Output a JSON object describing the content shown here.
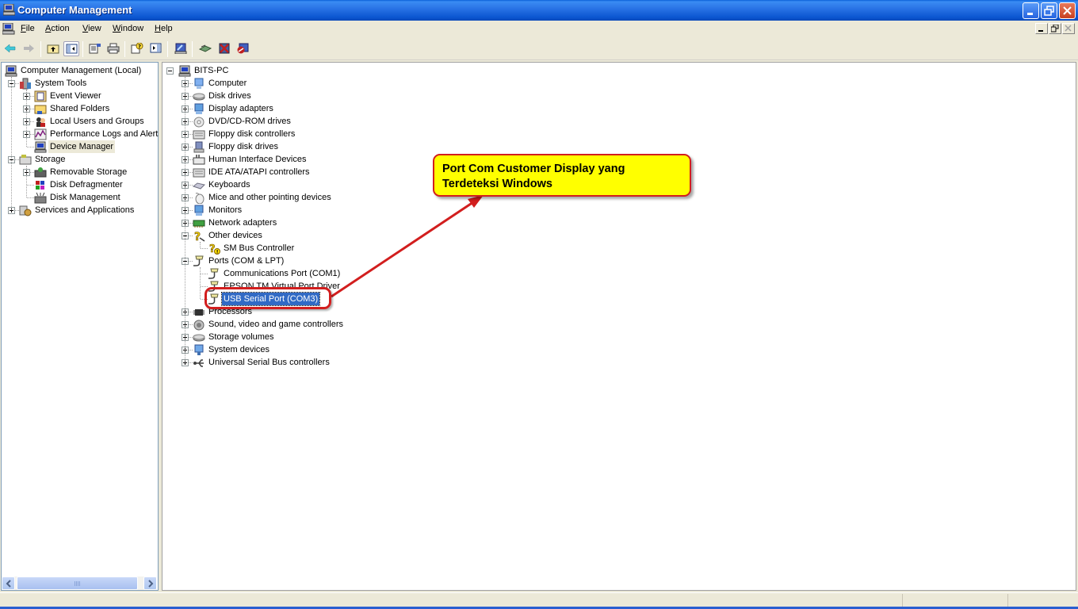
{
  "window": {
    "title": "Computer Management",
    "controls": {
      "minimize": "minimize",
      "restore": "restore",
      "close": "close"
    }
  },
  "menubar": {
    "items": [
      {
        "label": "File",
        "accel": "F"
      },
      {
        "label": "Action",
        "accel": "A"
      },
      {
        "label": "View",
        "accel": "V"
      },
      {
        "label": "Window",
        "accel": "W"
      },
      {
        "label": "Help",
        "accel": "H"
      }
    ]
  },
  "toolbar": {
    "buttons": [
      {
        "name": "back",
        "icon": "back-arrow-icon"
      },
      {
        "name": "forward",
        "icon": "forward-arrow-icon",
        "disabled": true
      },
      {
        "name": "up-one-level",
        "icon": "folder-up-icon"
      },
      {
        "name": "show-hide-console-tree",
        "icon": "console-tree-icon",
        "pressed": true
      },
      {
        "name": "properties",
        "icon": "properties-icon"
      },
      {
        "name": "print",
        "icon": "printer-icon"
      },
      {
        "name": "help",
        "icon": "help-icon"
      },
      {
        "name": "show-hide-action-pane",
        "icon": "action-pane-icon"
      },
      {
        "name": "scan-hardware-changes",
        "icon": "scan-hardware-icon"
      },
      {
        "name": "update-driver",
        "icon": "update-driver-icon"
      },
      {
        "name": "uninstall",
        "icon": "uninstall-icon"
      },
      {
        "name": "disable",
        "icon": "disable-icon"
      }
    ]
  },
  "console_tree": {
    "root": "Computer Management (Local)",
    "items": [
      {
        "label": "System Tools",
        "level": 1,
        "expander": "minus",
        "icon": "system-tools-icon"
      },
      {
        "label": "Event Viewer",
        "level": 2,
        "expander": "plus",
        "icon": "event-viewer-icon"
      },
      {
        "label": "Shared Folders",
        "level": 2,
        "expander": "plus",
        "icon": "shared-folders-icon"
      },
      {
        "label": "Local Users and Groups",
        "level": 2,
        "expander": "plus",
        "icon": "users-icon"
      },
      {
        "label": "Performance Logs and Alerts",
        "level": 2,
        "expander": "plus",
        "icon": "performance-icon"
      },
      {
        "label": "Device Manager",
        "level": 2,
        "expander": "none",
        "icon": "device-manager-icon",
        "selected": true
      },
      {
        "label": "Storage",
        "level": 1,
        "expander": "minus",
        "icon": "storage-icon"
      },
      {
        "label": "Removable Storage",
        "level": 2,
        "expander": "plus",
        "icon": "removable-storage-icon"
      },
      {
        "label": "Disk Defragmenter",
        "level": 2,
        "expander": "none",
        "icon": "defragmenter-icon"
      },
      {
        "label": "Disk Management",
        "level": 2,
        "expander": "none",
        "icon": "disk-management-icon"
      },
      {
        "label": "Services and Applications",
        "level": 1,
        "expander": "plus",
        "icon": "services-icon"
      }
    ]
  },
  "device_tree": {
    "root": "BITS-PC",
    "items": [
      {
        "label": "Computer",
        "level": 1,
        "expander": "plus",
        "icon": "computer-icon"
      },
      {
        "label": "Disk drives",
        "level": 1,
        "expander": "plus",
        "icon": "disk-drive-icon"
      },
      {
        "label": "Display adapters",
        "level": 1,
        "expander": "plus",
        "icon": "display-adapter-icon"
      },
      {
        "label": "DVD/CD-ROM drives",
        "level": 1,
        "expander": "plus",
        "icon": "cdrom-icon"
      },
      {
        "label": "Floppy disk controllers",
        "level": 1,
        "expander": "plus",
        "icon": "controller-icon"
      },
      {
        "label": "Floppy disk drives",
        "level": 1,
        "expander": "plus",
        "icon": "floppy-icon"
      },
      {
        "label": "Human Interface Devices",
        "level": 1,
        "expander": "plus",
        "icon": "hid-icon"
      },
      {
        "label": "IDE ATA/ATAPI controllers",
        "level": 1,
        "expander": "plus",
        "icon": "controller-icon"
      },
      {
        "label": "Keyboards",
        "level": 1,
        "expander": "plus",
        "icon": "keyboard-icon"
      },
      {
        "label": "Mice and other pointing devices",
        "level": 1,
        "expander": "plus",
        "icon": "mouse-icon"
      },
      {
        "label": "Monitors",
        "level": 1,
        "expander": "plus",
        "icon": "monitor-icon"
      },
      {
        "label": "Network adapters",
        "level": 1,
        "expander": "plus",
        "icon": "network-adapter-icon"
      },
      {
        "label": "Other devices",
        "level": 1,
        "expander": "minus",
        "icon": "unknown-device-icon"
      },
      {
        "label": "SM Bus Controller",
        "level": 2,
        "expander": "none",
        "icon": "warning-device-icon"
      },
      {
        "label": "Ports (COM & LPT)",
        "level": 1,
        "expander": "minus",
        "icon": "port-icon"
      },
      {
        "label": "Communications Port (COM1)",
        "level": 2,
        "expander": "none",
        "icon": "port-icon"
      },
      {
        "label": "EPSON TM Virtual Port Driver",
        "level": 2,
        "expander": "none",
        "icon": "port-icon"
      },
      {
        "label": "USB Serial Port (COM3)",
        "level": 2,
        "expander": "none",
        "icon": "port-icon",
        "selected": true
      },
      {
        "label": "Processors",
        "level": 1,
        "expander": "plus",
        "icon": "processor-icon"
      },
      {
        "label": "Sound, video and game controllers",
        "level": 1,
        "expander": "plus",
        "icon": "sound-icon"
      },
      {
        "label": "Storage volumes",
        "level": 1,
        "expander": "plus",
        "icon": "disk-drive-icon"
      },
      {
        "label": "System devices",
        "level": 1,
        "expander": "plus",
        "icon": "system-device-icon"
      },
      {
        "label": "Universal Serial Bus controllers",
        "level": 1,
        "expander": "plus",
        "icon": "usb-icon"
      }
    ]
  },
  "annotation": {
    "callout_line1": "Port Com Customer Display yang",
    "callout_line2": "Terdeteksi Windows",
    "highlight_target": "USB Serial Port (COM3)",
    "color": "#d21e1e",
    "fill": "#ffff00"
  },
  "colors": {
    "selection": "#316ac5",
    "titlebar": "#0a55d0",
    "chrome": "#ece9d8"
  }
}
